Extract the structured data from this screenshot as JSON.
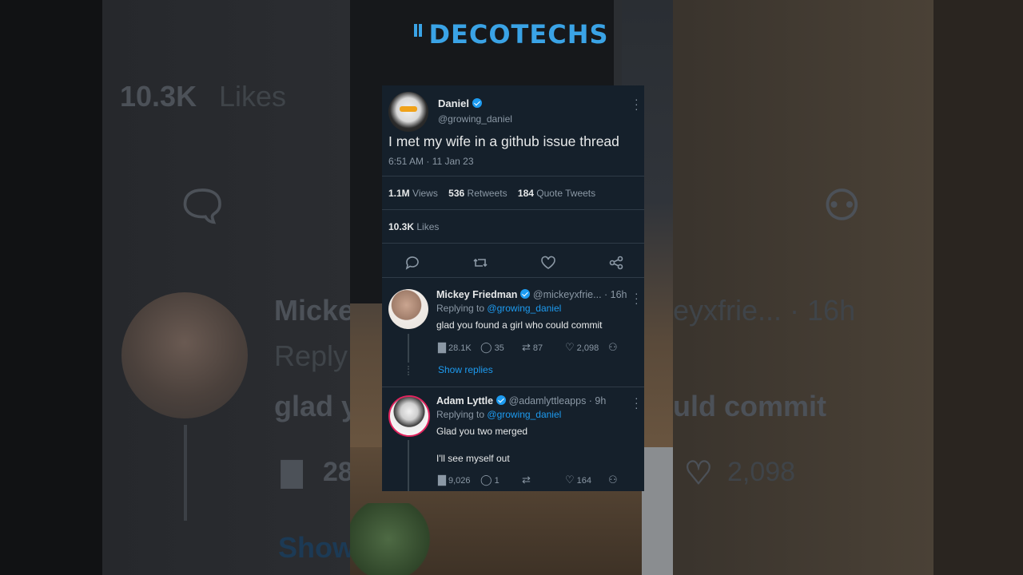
{
  "brand": {
    "logo_text": "DECOTECHS",
    "color": "#3aa3e6"
  },
  "background_ghost": {
    "likes_count": "10.3K",
    "likes_label": "Likes",
    "reply_name": "Micke",
    "reply_handle_fragment": "eyxfrie... · 16h",
    "reply_sub": "Reply",
    "reply_text_start": "glad y",
    "reply_text_end": "uld commit",
    "views_fragment": "28",
    "likes_fragment": "2,098",
    "show_fragment": "Show"
  },
  "tweet": {
    "author_name": "Daniel",
    "author_handle": "@growing_daniel",
    "text": "I met my wife in a github issue thread",
    "timestamp": "6:51 AM · 11 Jan 23",
    "views_count": "1.1M",
    "views_label": "Views",
    "retweets_count": "536",
    "retweets_label": "Retweets",
    "quotes_count": "184",
    "quotes_label": "Quote Tweets",
    "likes_count": "10.3K",
    "likes_label": "Likes",
    "more_icon": "more-icon",
    "accent": "#1d9bf0"
  },
  "replies": [
    {
      "name": "Mickey Friedman",
      "meta": "@mickeyxfrie... · 16h",
      "replying_prefix": "Replying to",
      "replying_to": "@growing_daniel",
      "text_lines": [
        "glad you found a girl who could commit"
      ],
      "views": "28.1K",
      "comments": "35",
      "retweets": "87",
      "likes": "2,098",
      "show_replies": "Show replies"
    },
    {
      "name": "Adam Lyttle",
      "meta": "@adamlyttleapps · 9h",
      "replying_prefix": "Replying to",
      "replying_to": "@growing_daniel",
      "text_lines": [
        "Glad you two merged",
        "I'll see myself out"
      ],
      "views": "9,026",
      "comments": "1",
      "retweets": "",
      "likes": "164"
    }
  ]
}
